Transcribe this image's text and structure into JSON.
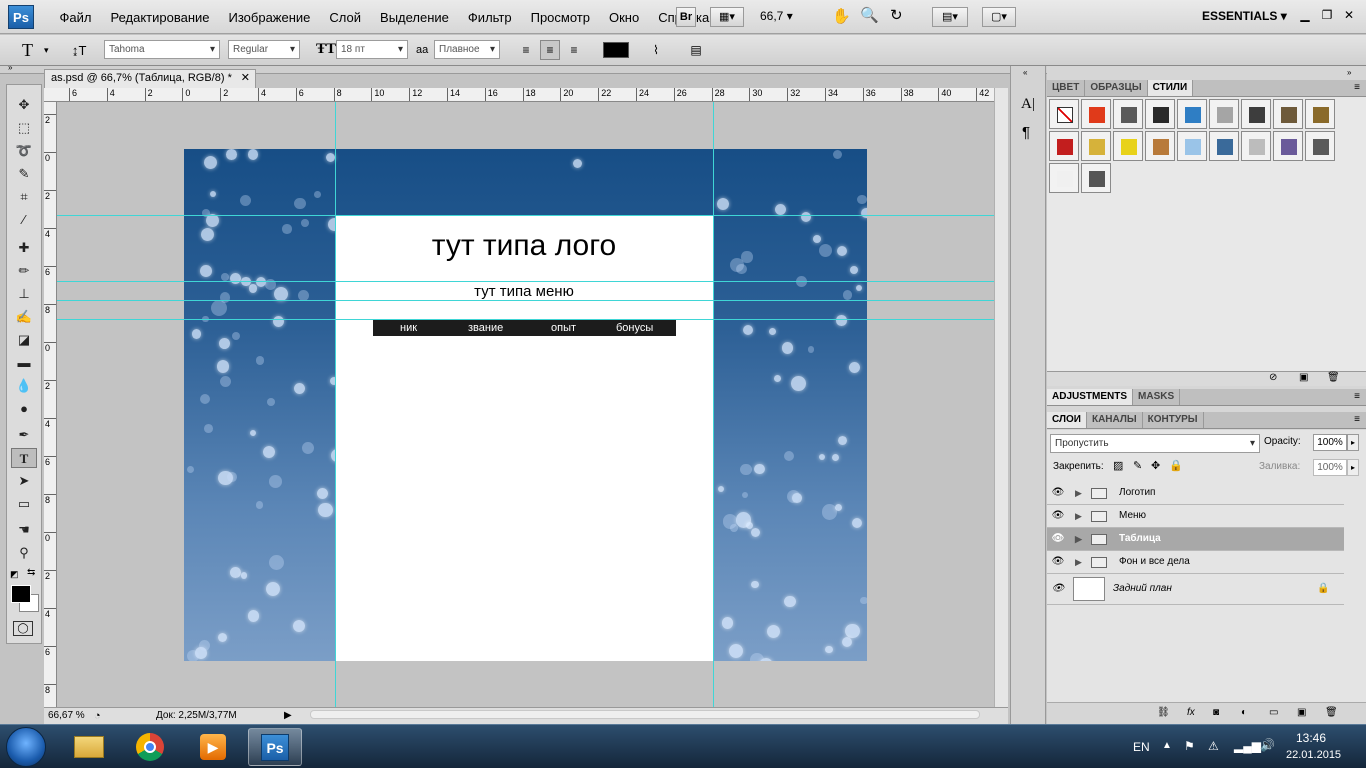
{
  "app": {
    "logo": "Ps",
    "menu": [
      "Файл",
      "Редактирование",
      "Изображение",
      "Слой",
      "Выделение",
      "Фильтр",
      "Просмотр",
      "Окно",
      "Справка"
    ],
    "br_label": "Br",
    "zoom_value": "66,7",
    "workspace": "ESSENTIALS"
  },
  "options": {
    "tool_glyph": "T",
    "font_family": "Tahoma",
    "font_style": "Regular",
    "font_size": "18 пт",
    "aa_label": "aa",
    "antialias": "Плавное",
    "text_color": "#000000"
  },
  "document": {
    "tab_title": "as.psd @ 66,7% (Таблица, RGB/8) *",
    "close": "✕",
    "ruler_top": [
      "6",
      "4",
      "2",
      "0",
      "2",
      "4",
      "6",
      "8",
      "10",
      "12",
      "14",
      "16",
      "18",
      "20",
      "22",
      "24",
      "26",
      "28",
      "30",
      "32",
      "34",
      "36",
      "38",
      "40",
      "42"
    ],
    "ruler_left": [
      "2",
      "0",
      "2",
      "4",
      "6",
      "8",
      "0",
      "2",
      "4",
      "6",
      "8",
      "0",
      "2",
      "4",
      "6",
      "8"
    ],
    "logo_text": "тут типа лого",
    "menu_text": "тут типа меню",
    "table_headers": [
      "ник",
      "звание",
      "опыт",
      "бонусы"
    ]
  },
  "status": {
    "zoom": "66,67 %",
    "doc": "Док: 2,25M/3,77M"
  },
  "panels": {
    "top_tabs": [
      "ЦВЕТ",
      "ОБРАЗЦЫ",
      "СТИЛИ"
    ],
    "top_active": 2,
    "adj_tabs": [
      "ADJUSTMENTS",
      "MASKS"
    ],
    "layer_tabs": [
      "СЛОИ",
      "КАНАЛЫ",
      "КОНТУРЫ"
    ],
    "blend_mode": "Пропустить",
    "opacity_label": "Opacity:",
    "opacity_value": "100%",
    "lock_label": "Закрепить:",
    "fill_label": "Заливка:",
    "fill_value": "100%",
    "layers": [
      {
        "name": "Логотип",
        "type": "group",
        "selected": false
      },
      {
        "name": "Меню",
        "type": "group",
        "selected": false
      },
      {
        "name": "Таблица",
        "type": "group",
        "selected": true
      },
      {
        "name": "Фон и все дела",
        "type": "group",
        "selected": false
      },
      {
        "name": "Задний план",
        "type": "background",
        "selected": false
      }
    ],
    "swatch_colors": [
      "#ffffff",
      "#e03a1a",
      "#5a5a5a",
      "#2a2a2a",
      "#2f7ec4",
      "#a5a5a5",
      "#3d3d3d",
      "#6e5a3a",
      "#8a6a2a",
      "#c21e1e",
      "#d6b23a",
      "#e8d21a",
      "#b87a3a",
      "#9ac4e8",
      "#3a6a9a",
      "#bcbcbc",
      "#6a5a9a",
      "#5a5a5a",
      "#f0f0f0",
      "#555555"
    ]
  },
  "taskbar": {
    "lang": "EN",
    "time": "13:46",
    "date": "22.01.2015",
    "ps_label": "Ps"
  }
}
